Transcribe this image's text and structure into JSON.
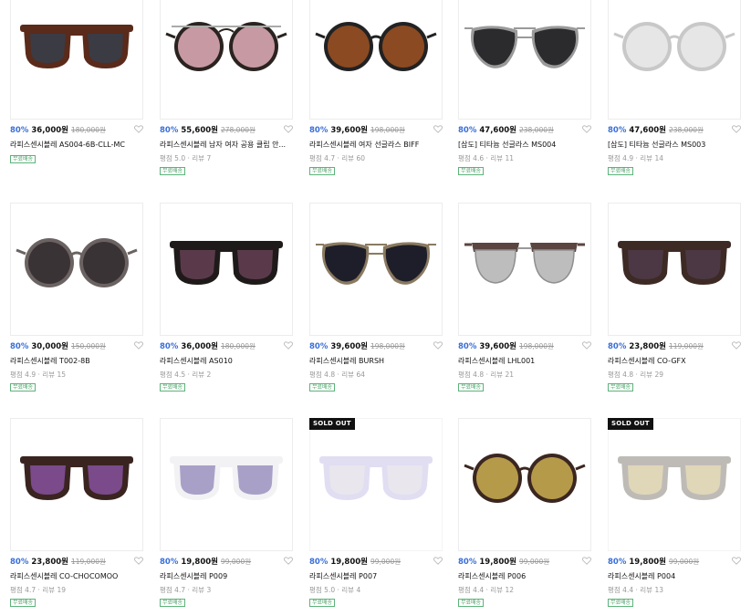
{
  "products": [
    {
      "discount": "80%",
      "price": "36,000원",
      "original_price": "180,000원",
      "name": "라피스센시블레 AS004-6B-CLL-MC",
      "rating": "",
      "tag": "무료배송",
      "sold_out": false,
      "style": {
        "shape": "square",
        "frame": "#5a2a1a",
        "lens": "#3b3b44",
        "bridge": "solid"
      }
    },
    {
      "discount": "80%",
      "price": "55,600원",
      "original_price": "278,000원",
      "name": "라피스센시블레 남자 여자 공용 클립 안...",
      "rating": "평점 5.0 · 리뷰 7",
      "tag": "무료배송",
      "sold_out": false,
      "style": {
        "shape": "round",
        "frame": "#2a2320",
        "lens": "#c79aa3",
        "bridge": "double"
      }
    },
    {
      "discount": "80%",
      "price": "39,600원",
      "original_price": "198,000원",
      "name": "라피스센시블레 여자 선글라스 BIFF",
      "rating": "평점 4.7 · 리뷰 60",
      "tag": "무료배송",
      "sold_out": false,
      "style": {
        "shape": "round",
        "frame": "#222222",
        "lens": "#8b4a22",
        "bridge": "thin"
      }
    },
    {
      "discount": "80%",
      "price": "47,600원",
      "original_price": "238,000원",
      "name": "[삼도] 티타늄 선글라스 MS004",
      "rating": "평점 4.6 · 리뷰 11",
      "tag": "무료배송",
      "sold_out": false,
      "style": {
        "shape": "aviator",
        "frame": "#9a9a9a",
        "lens": "#2b2b2e",
        "bridge": "double"
      }
    },
    {
      "discount": "80%",
      "price": "47,600원",
      "original_price": "238,000원",
      "name": "[삼도] 티타늄 선글라스 MS003",
      "rating": "평점 4.9 · 리뷰 14",
      "tag": "무료배송",
      "sold_out": false,
      "style": {
        "shape": "round",
        "frame": "#c8c8c8",
        "lens": "#e6e6e6",
        "bridge": "thin"
      }
    },
    {
      "discount": "80%",
      "price": "30,000원",
      "original_price": "150,000원",
      "name": "라피스센시블레 T002-8B",
      "rating": "평점 4.9 · 리뷰 15",
      "tag": "무료배송",
      "sold_out": false,
      "style": {
        "shape": "round",
        "frame": "#6b6262",
        "lens": "#3a3336",
        "bridge": "solid"
      }
    },
    {
      "discount": "80%",
      "price": "36,000원",
      "original_price": "180,000원",
      "name": "라피스센시블레 AS010",
      "rating": "평점 4.5 · 리뷰 2",
      "tag": "무료배송",
      "sold_out": false,
      "style": {
        "shape": "square",
        "frame": "#1f1a1a",
        "lens": "#5a3a4a",
        "bridge": "solid"
      }
    },
    {
      "discount": "80%",
      "price": "39,600원",
      "original_price": "198,000원",
      "name": "라피스센시블레 BURSH",
      "rating": "평점 4.8 · 리뷰 64",
      "tag": "무료배송",
      "sold_out": false,
      "style": {
        "shape": "aviator",
        "frame": "#8a7a60",
        "lens": "#1e1e2a",
        "bridge": "double"
      }
    },
    {
      "discount": "80%",
      "price": "39,600원",
      "original_price": "198,000원",
      "name": "라피스센시블레 LHL001",
      "rating": "평점 4.8 · 리뷰 21",
      "tag": "무료배송",
      "sold_out": false,
      "style": {
        "shape": "browline",
        "frame": "#5b4540",
        "lens": "#bdbdbd",
        "bridge": "thin"
      }
    },
    {
      "discount": "80%",
      "price": "23,800원",
      "original_price": "119,000원",
      "name": "라피스센시블레 CO-GFX",
      "rating": "평점 4.8 · 리뷰 29",
      "tag": "무료배송",
      "sold_out": false,
      "style": {
        "shape": "square",
        "frame": "#3d2a24",
        "lens": "#4b3844",
        "bridge": "solid"
      }
    },
    {
      "discount": "80%",
      "price": "23,800원",
      "original_price": "119,000원",
      "name": "라피스센시블레 CO-CHOCOMOO",
      "rating": "평점 4.7 · 리뷰 19",
      "tag": "무료배송",
      "sold_out": false,
      "style": {
        "shape": "square",
        "frame": "#3a2420",
        "lens": "#7a4a8a",
        "bridge": "solid"
      }
    },
    {
      "discount": "80%",
      "price": "19,800원",
      "original_price": "99,000원",
      "name": "라피스센시블레 P009",
      "rating": "평점 4.7 · 리뷰 3",
      "tag": "무료배송",
      "sold_out": false,
      "style": {
        "shape": "square",
        "frame": "#f2f2f4",
        "lens": "#a9a0c8",
        "bridge": "solid"
      }
    },
    {
      "discount": "80%",
      "price": "19,800원",
      "original_price": "99,000원",
      "name": "라피스센시블레 P007",
      "rating": "평점 5.0 · 리뷰 4",
      "tag": "무료배송",
      "sold_out": true,
      "style": {
        "shape": "square",
        "frame": "#c9c4e8",
        "lens": "#d8d4e0",
        "bridge": "solid"
      }
    },
    {
      "discount": "80%",
      "price": "19,800원",
      "original_price": "99,000원",
      "name": "라피스센시블레 P006",
      "rating": "평점 4.4 · 리뷰 12",
      "tag": "무료배송",
      "sold_out": false,
      "style": {
        "shape": "round",
        "frame": "#3b2620",
        "lens": "#b59a4a",
        "bridge": "solid"
      }
    },
    {
      "discount": "80%",
      "price": "19,800원",
      "original_price": "99,000원",
      "name": "라피스센시블레 P004",
      "rating": "평점 4.4 · 리뷰 13",
      "tag": "무료배송",
      "sold_out": true,
      "style": {
        "shape": "square",
        "frame": "#8a847e",
        "lens": "#c8b880",
        "bridge": "solid"
      }
    }
  ],
  "sold_out_label": "SOLD OUT",
  "colors": {
    "discount": "#3a6fd8",
    "tag_border": "#5db37a"
  }
}
